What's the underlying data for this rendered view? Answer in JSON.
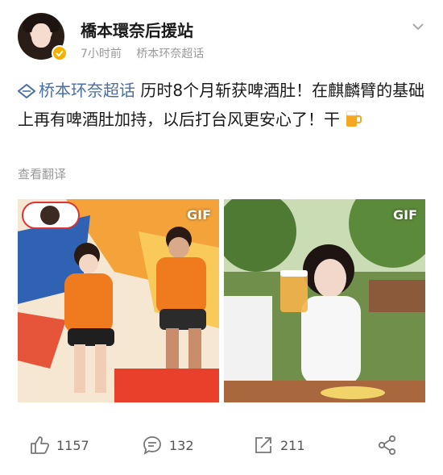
{
  "post": {
    "author": "橋本環奈后援站",
    "time": "7小时前",
    "source": "桥本环奈超话",
    "topic": "桥本环奈超话",
    "text": "历时8个月斩获啤酒肚！在麒麟臂的基础上再有啤酒肚加持，以后打台风更安心了！干",
    "translate_label": "查看翻译"
  },
  "media": [
    {
      "badge": "GIF"
    },
    {
      "badge": "GIF"
    }
  ],
  "actions": {
    "likes": "1157",
    "comments": "132",
    "reposts": "211"
  },
  "icons": [
    "verified-badge-icon",
    "chevron-down-icon",
    "topic-icon",
    "beer-icon",
    "like-icon",
    "comment-icon",
    "repost-icon",
    "share-icon"
  ],
  "colors": {
    "topic": "#4a6fa5",
    "meta": "#999999",
    "verified": "#f6b100"
  }
}
